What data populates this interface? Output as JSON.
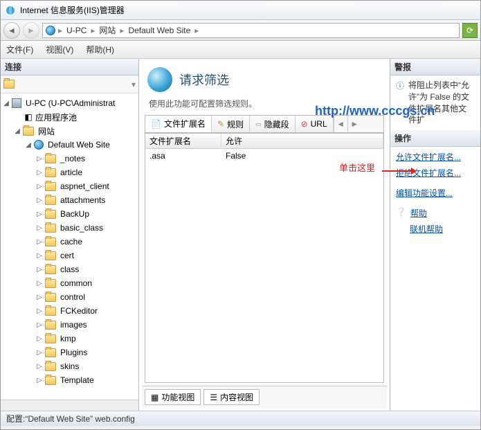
{
  "window": {
    "title": "Internet 信息服务(IIS)管理器"
  },
  "breadcrumb": {
    "root": "U-PC",
    "node1": "网站",
    "node2": "Default Web Site"
  },
  "menu": {
    "file": "文件(F)",
    "view": "视图(V)",
    "help": "帮助(H)"
  },
  "sidebar": {
    "header": "连接",
    "root": "U-PC (U-PC\\Administrat",
    "apppool": "应用程序池",
    "sites": "网站",
    "defaultsite": "Default Web Site",
    "folders": [
      "_notes",
      "article",
      "aspnet_client",
      "attachments",
      "BackUp",
      "basic_class",
      "cache",
      "cert",
      "class",
      "common",
      "control",
      "FCKeditor",
      "images",
      "kmp",
      "Plugins",
      "skins",
      "Template"
    ]
  },
  "main": {
    "title": "请求筛选",
    "desc": "使用此功能可配置筛选规则。",
    "tabs": {
      "ext": "文件扩展名",
      "rules": "规则",
      "hidden": "隐藏段",
      "url": "URL"
    },
    "grid": {
      "col1": "文件扩展名",
      "col2": "允许",
      "row1c1": ".asa",
      "row1c2": "False"
    },
    "views": {
      "feature": "功能视图",
      "content": "内容视图"
    }
  },
  "actions": {
    "alertHeader": "警报",
    "alertText": "将阻止列表中“允许”为 False 的文件扩展名其他文件扩",
    "header": "操作",
    "allow": "允许文件扩展名...",
    "deny": "拒绝文件扩展名...",
    "edit": "编辑功能设置...",
    "help": "帮助",
    "onlinehelp": "联机帮助"
  },
  "status": {
    "text": "配置:“Default Web Site” web.config"
  },
  "watermark": "http://www.cccgs.cn",
  "annotation": "单击这里"
}
